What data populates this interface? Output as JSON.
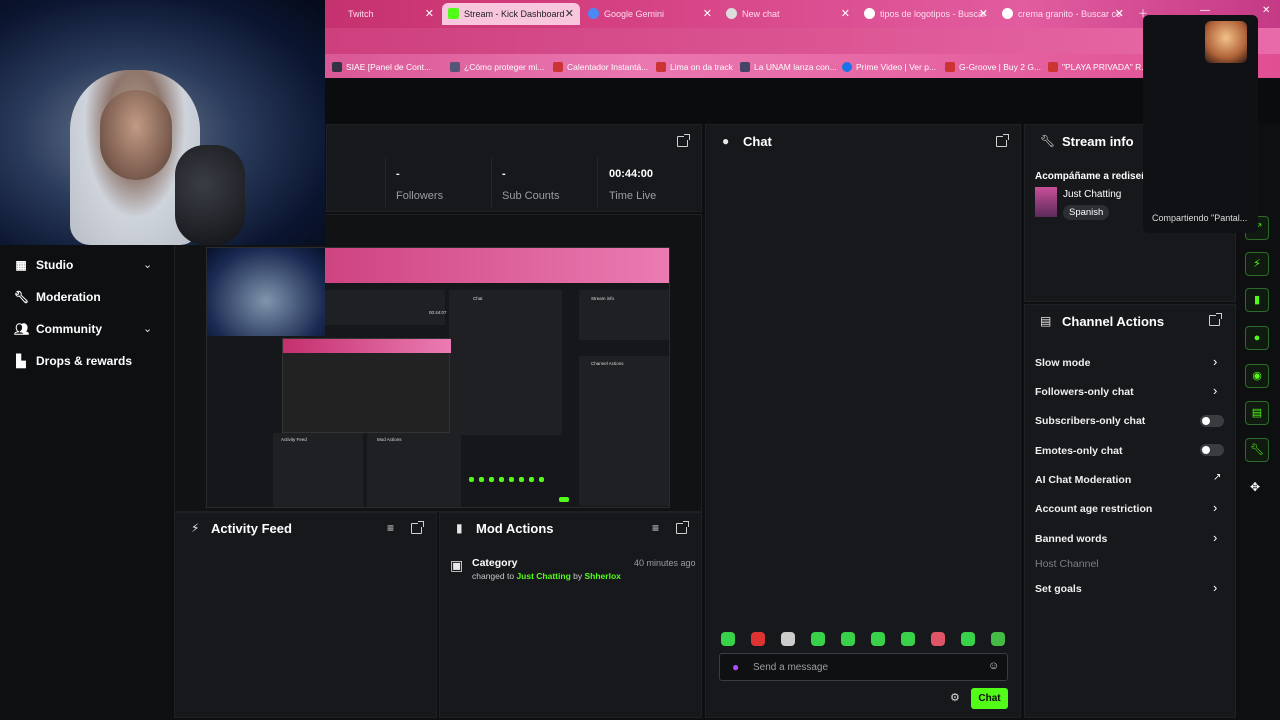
{
  "browser": {
    "tabs": [
      {
        "label": "Twitch",
        "color": "#9146ff"
      },
      {
        "label": "Stream - Kick Dashboard",
        "color": "#53fc18"
      },
      {
        "label": "Google Gemini",
        "color": "#4a8af4"
      },
      {
        "label": "New chat",
        "color": "#cccccc"
      },
      {
        "label": "tipos de logotipos - Buscar",
        "color": "#4285f4"
      },
      {
        "label": "crema granito - Buscar co",
        "color": "#4285f4"
      }
    ],
    "bookmarks": [
      "SIAE [Panel de Cont...",
      "¿Cómo proteger mi...",
      "Calentador Instantá...",
      "Lima on da track",
      "La UNAM lanza con...",
      "Prime Video | Ver p...",
      "G-Groove | Buy 2 G...",
      "\"PLAYA PRIVADA\" R..."
    ]
  },
  "stats": [
    {
      "value": "-",
      "label": "Followers"
    },
    {
      "value": "-",
      "label": "Sub Counts"
    },
    {
      "value": "00:44:00",
      "label": "Time Live"
    }
  ],
  "sidebar": {
    "items": [
      {
        "label": "Studio",
        "icon": "studio-icon"
      },
      {
        "label": "Moderation",
        "icon": "wrench-icon"
      },
      {
        "label": "Community",
        "icon": "people-icon"
      },
      {
        "label": "Drops & rewards",
        "icon": "chart-icon"
      }
    ]
  },
  "chat": {
    "title": "Chat",
    "placeholder": "Send a message",
    "send_label": "Chat"
  },
  "stream_info": {
    "title": "Stream info",
    "stream_title": "Acompáñame a rediseña",
    "category": "Just Chatting",
    "language": "Spanish"
  },
  "share": {
    "text": "Compartiendo \"Pantal..."
  },
  "channel_actions": {
    "title": "Channel Actions",
    "items": [
      {
        "label": "Slow mode"
      },
      {
        "label": "Followers-only chat"
      },
      {
        "label": "Subscribers-only chat"
      },
      {
        "label": "Emotes-only chat"
      },
      {
        "label": "AI Chat Moderation"
      },
      {
        "label": "Account age restriction"
      },
      {
        "label": "Banned words"
      },
      {
        "label": "Host Channel"
      },
      {
        "label": "Set goals"
      }
    ]
  },
  "activity_feed": {
    "title": "Activity Feed"
  },
  "mod_actions": {
    "title": "Mod Actions",
    "entry_title": "Category",
    "entry_time": "40 minutes ago",
    "entry_prefix": "changed to",
    "entry_category": "Just Chatting",
    "entry_by": "by",
    "entry_user": "Shherlox"
  },
  "nested": {
    "chat": "Chat",
    "stream_info": "Stream info",
    "channel_actions": "Channel Actions",
    "activity_feed": "Activity Feed",
    "mod_actions": "Mod Actions",
    "time": "00:44:07"
  },
  "colors": {
    "accent": "#53fc18",
    "panel": "#17181b"
  }
}
